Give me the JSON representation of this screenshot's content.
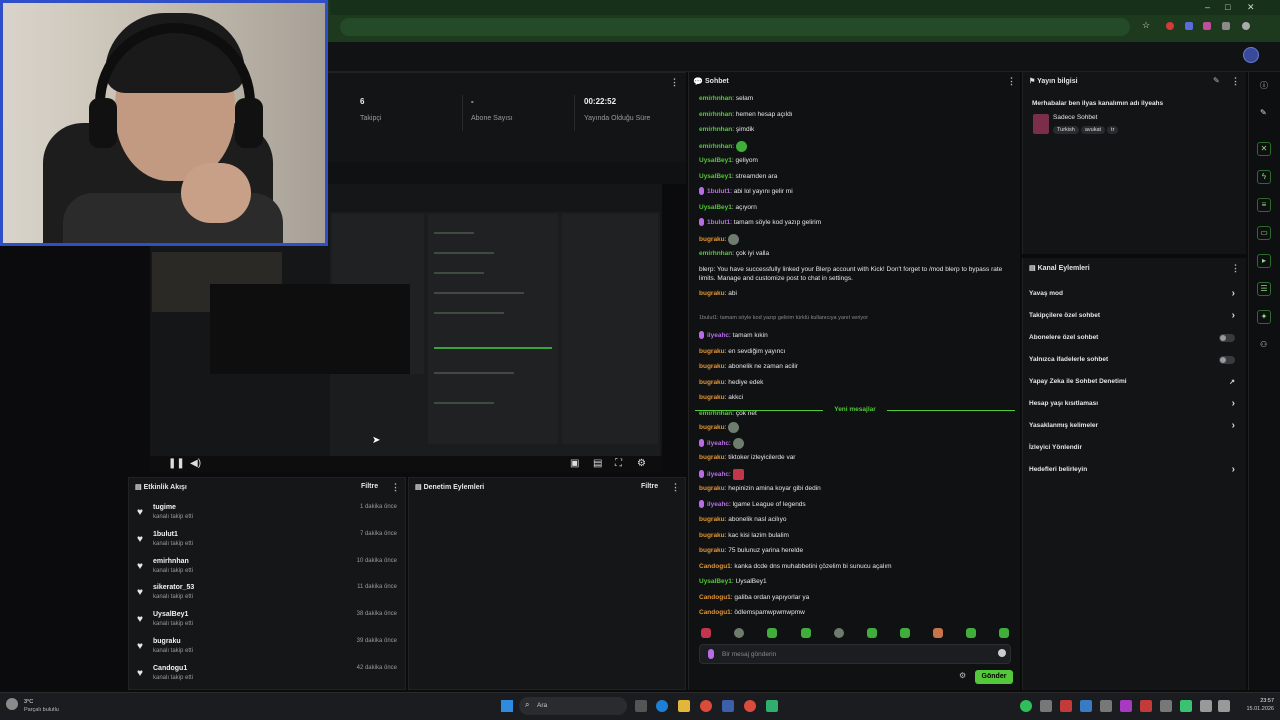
{
  "browser": {
    "window_controls": [
      "–",
      "□",
      "✕"
    ]
  },
  "stats": [
    {
      "value": "6",
      "label": "Takipçi"
    },
    {
      "value": "-",
      "label": "Abone Sayısı"
    },
    {
      "value": "00:22:52",
      "label": "Yayında Olduğu Süre"
    }
  ],
  "activity": {
    "title": "Etkinlik Akışı",
    "filter": "Filtre",
    "events": [
      {
        "name": "tugime",
        "sub": "kanalı takip etti",
        "time": "1 dakika önce"
      },
      {
        "name": "1bulut1",
        "sub": "kanalı takip etti",
        "time": "7 dakika önce"
      },
      {
        "name": "emirhnhan",
        "sub": "kanalı takip etti",
        "time": "10 dakika önce"
      },
      {
        "name": "sikerator_53",
        "sub": "kanalı takip etti",
        "time": "11 dakika önce"
      },
      {
        "name": "UysalBey1",
        "sub": "kanalı takip etti",
        "time": "38 dakika önce"
      },
      {
        "name": "bugraku",
        "sub": "kanalı takip etti",
        "time": "39 dakika önce"
      },
      {
        "name": "Candogu1",
        "sub": "kanalı takip etti",
        "time": "42 dakika önce"
      }
    ]
  },
  "moderation": {
    "title": "Denetim Eylemleri",
    "filter": "Filtre"
  },
  "chat": {
    "title": "Sohbet",
    "new_messages": "Yeni mesajlar",
    "placeholder": "Bir mesaj gönderin",
    "send": "Gönder",
    "messages_before": [
      {
        "user": "emirhnhan",
        "c": "g",
        "text": "selam"
      },
      {
        "user": "emirhnhan",
        "c": "g",
        "text": "hemen hesap açıldı"
      },
      {
        "user": "emirhnhan",
        "c": "g",
        "text": "şimdik"
      },
      {
        "user": "emirhnhan",
        "c": "g",
        "text": "",
        "emote": "green"
      },
      {
        "user": "UysalBey1",
        "c": "g",
        "text": "geliyom"
      },
      {
        "user": "UysalBey1",
        "c": "g",
        "text": "streamden ara"
      },
      {
        "user": "1bulut1",
        "c": "p",
        "text": "abi lol yayını gelir mi"
      },
      {
        "user": "UysalBey1",
        "c": "g",
        "text": "açıyorn"
      },
      {
        "user": "1bulut1",
        "c": "p",
        "text": "tamam söyle kod yazıp gelirim"
      },
      {
        "user": "bugraku",
        "c": "o",
        "text": "",
        "emote": "gray"
      },
      {
        "user": "emirhnhan",
        "c": "g",
        "text": "çok iyi valla"
      },
      {
        "user": "",
        "c": "g",
        "text": "blerp: You have successfully linked your Blerp account with Kick! Don't forget to /mod blerp to bypass rate limits. Manage and customize post to chat in settings."
      },
      {
        "user": "bugraku",
        "c": "o",
        "text": "abi"
      },
      {
        "user": "",
        "c": "g",
        "text": "1bulut1: tamam söyle kod yazıp gelirim türklü kullanıcıya yanıt veriyor"
      },
      {
        "user": "ilyeahc",
        "c": "p",
        "text": "tamam kıkin"
      },
      {
        "user": "bugraku",
        "c": "o",
        "text": "en sevdiğim yayıncı"
      },
      {
        "user": "bugraku",
        "c": "o",
        "text": "abonelik ne zaman acilir"
      },
      {
        "user": "bugraku",
        "c": "o",
        "text": "hediye edek"
      },
      {
        "user": "bugraku",
        "c": "o",
        "text": "akkci"
      },
      {
        "user": "emirhnhan",
        "c": "g",
        "text": "çok net"
      }
    ],
    "messages_after": [
      {
        "user": "bugraku",
        "c": "o",
        "text": "",
        "emote": "gray"
      },
      {
        "user": "ilyeahc",
        "c": "p",
        "text": "",
        "emote": "gray"
      },
      {
        "user": "bugraku",
        "c": "o",
        "text": "tiktoker izleyicilerde var"
      },
      {
        "user": "ilyeahc",
        "c": "p",
        "text": "",
        "emote": "red"
      },
      {
        "user": "bugraku",
        "c": "o",
        "text": "hepinizin amina koyar gibi dedin"
      },
      {
        "user": "ilyeahc",
        "c": "p",
        "text": "lgame League of legends"
      },
      {
        "user": "bugraku",
        "c": "o",
        "text": "abonelik nasl acilıyo"
      },
      {
        "user": "bugraku",
        "c": "o",
        "text": "kac kisi lazim bulalim"
      },
      {
        "user": "bugraku",
        "c": "o",
        "text": "75 bulunuz yarina herelde"
      },
      {
        "user": "Candogu1",
        "c": "o",
        "text": "kanka dcde dns muhabbetini çözelim bi sunucu açalım"
      },
      {
        "user": "UysalBey1",
        "c": "g",
        "text": "UysalBey1"
      },
      {
        "user": "Candogu1",
        "c": "o",
        "text": "galiba ordan yapıyorlar ya"
      },
      {
        "user": "Candogu1",
        "c": "o",
        "text": "ödlemspamwpwmwpmw"
      }
    ]
  },
  "info": {
    "title": "Yayın bilgisi",
    "stream_title": "Merhabalar ben ilyas kanalımın adı ilyeahs",
    "category": "Sadece Sohbet",
    "tags": [
      "Turkish",
      "avukat",
      "tr"
    ]
  },
  "actions": {
    "title": "Kanal Eylemleri",
    "items": [
      {
        "label": "Yavaş mod",
        "ctl": "chev"
      },
      {
        "label": "Takipçilere özel sohbet",
        "ctl": "chev"
      },
      {
        "label": "Abonelere özel sohbet",
        "ctl": "toggle"
      },
      {
        "label": "Yalnızca ifadelerle sohbet",
        "ctl": "toggle"
      },
      {
        "label": "Yapay Zeka ile Sohbet Denetimi",
        "ctl": "ext"
      },
      {
        "label": "Hesap yaşı kısıtlaması",
        "ctl": "chev"
      },
      {
        "label": "Yasaklanmış kelimeler",
        "ctl": "chev"
      },
      {
        "label": "İzleyici Yönlendir",
        "ctl": ""
      },
      {
        "label": "Hedefleri belirleyin",
        "ctl": "chev"
      }
    ]
  },
  "taskbar": {
    "weather_temp": "3°C",
    "weather_text": "Parçalı bulutlu",
    "search": "Ara",
    "time": "23:57",
    "date": "15.01.2026"
  }
}
